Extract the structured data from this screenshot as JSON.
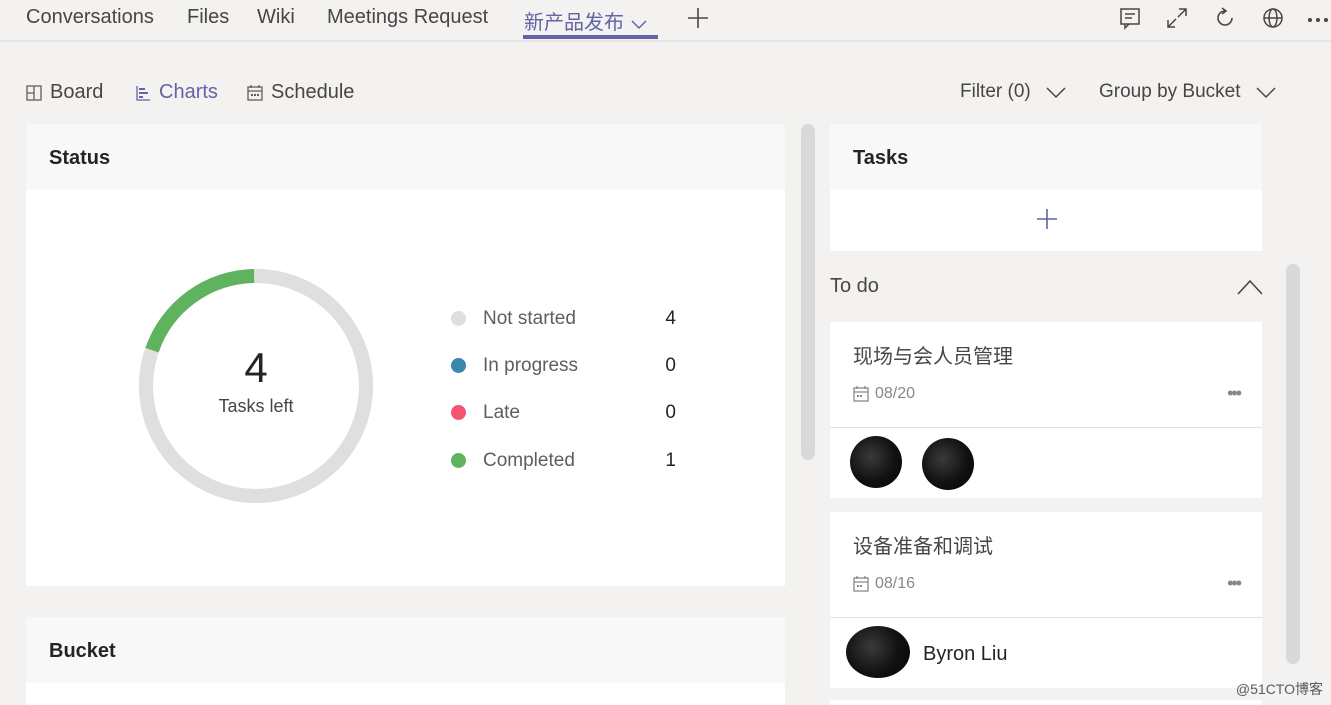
{
  "top_tabs": [
    {
      "label": "Conversations"
    },
    {
      "label": "Files"
    },
    {
      "label": "Wiki"
    },
    {
      "label": "Meetings Request"
    },
    {
      "label": "新产品发布"
    }
  ],
  "view_tabs": [
    {
      "label": "Board",
      "icon": "board-icon"
    },
    {
      "label": "Charts",
      "icon": "charts-icon"
    },
    {
      "label": "Schedule",
      "icon": "calendar-icon"
    }
  ],
  "toolbar": {
    "filter_label": "Filter (0)",
    "group_label": "Group by Bucket"
  },
  "status_card": {
    "title": "Status",
    "tasks_left_count": "4",
    "tasks_left_label": "Tasks left",
    "legend": [
      {
        "label": "Not started",
        "count": "4",
        "color": "#e1dfdd"
      },
      {
        "label": "In progress",
        "count": "0",
        "color": "#3a87ad"
      },
      {
        "label": "Late",
        "count": "0",
        "color": "#f1556f"
      },
      {
        "label": "Completed",
        "count": "1",
        "color": "#5fb35f"
      }
    ]
  },
  "chart_data": {
    "type": "pie",
    "categories": [
      "Not started",
      "In progress",
      "Late",
      "Completed"
    ],
    "values": [
      4,
      0,
      0,
      1
    ],
    "colors": [
      "#e1dfdd",
      "#3a87ad",
      "#f1556f",
      "#5fb35f"
    ]
  },
  "bucket_card": {
    "title": "Bucket"
  },
  "tasks_card": {
    "title": "Tasks"
  },
  "bucket": {
    "name": "To do",
    "tasks": [
      {
        "title": "现场与会人员管理",
        "due": "08/20"
      },
      {
        "title": "设备准备和调试",
        "due": "08/16",
        "assignee": "Byron Liu"
      }
    ]
  },
  "watermark": "@51CTO博客",
  "colors": {
    "accent": "#6264a7",
    "background": "#f3f2f1"
  }
}
